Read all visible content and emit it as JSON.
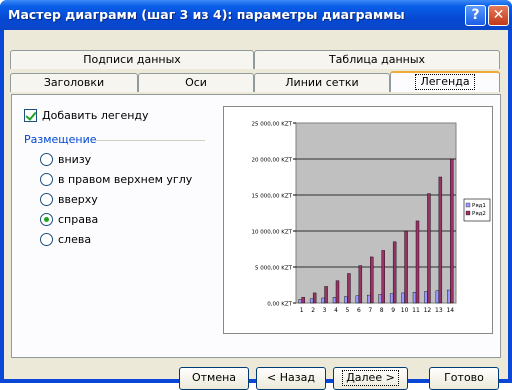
{
  "window": {
    "title": "Мастер диаграмм (шаг 3 из 4): параметры диаграммы",
    "help_icon": "question-mark",
    "close_icon": "x"
  },
  "tabs": {
    "back_row": [
      "Подписи данных",
      "Таблица данных"
    ],
    "front_row": [
      "Заголовки",
      "Оси",
      "Линии сетки",
      "Легенда"
    ],
    "active": "Легенда"
  },
  "legend_options": {
    "show_legend_label": "Добавить легенду",
    "show_legend_checked": true,
    "placement_group": "Размещение",
    "placements": [
      "внизу",
      "в правом верхнем углу",
      "вверху",
      "справа",
      "слева"
    ],
    "selected": "справа"
  },
  "chart_data": {
    "type": "bar",
    "categories": [
      "1",
      "2",
      "3",
      "4",
      "5",
      "6",
      "7",
      "8",
      "9",
      "10",
      "11",
      "12",
      "13",
      "14"
    ],
    "series": [
      {
        "name": "Ряд1",
        "values": [
          500,
          600,
          700,
          800,
          900,
          1000,
          1100,
          1200,
          1300,
          1400,
          1500,
          1600,
          1700,
          1800
        ]
      },
      {
        "name": "Ряд2",
        "values": [
          800,
          1400,
          2300,
          3100,
          4100,
          5200,
          6400,
          7300,
          8500,
          10000,
          11400,
          15200,
          17500,
          20000
        ]
      }
    ],
    "y_ticks": [
      "0,00 KZT",
      "5 000,00 KZT",
      "10 000,00 KZT",
      "15 000,00 KZT",
      "20 000,00 KZT",
      "25 000,00 KZT"
    ],
    "ylim": [
      0,
      25000
    ],
    "legend": "right",
    "grid": true,
    "colors": {
      "plot_bg": "#c0c0c0",
      "series1": "#9999ff",
      "series2": "#993366"
    }
  },
  "buttons": {
    "cancel": "Отмена",
    "back": "< Назад",
    "next": "Далее >",
    "finish": "Готово"
  }
}
